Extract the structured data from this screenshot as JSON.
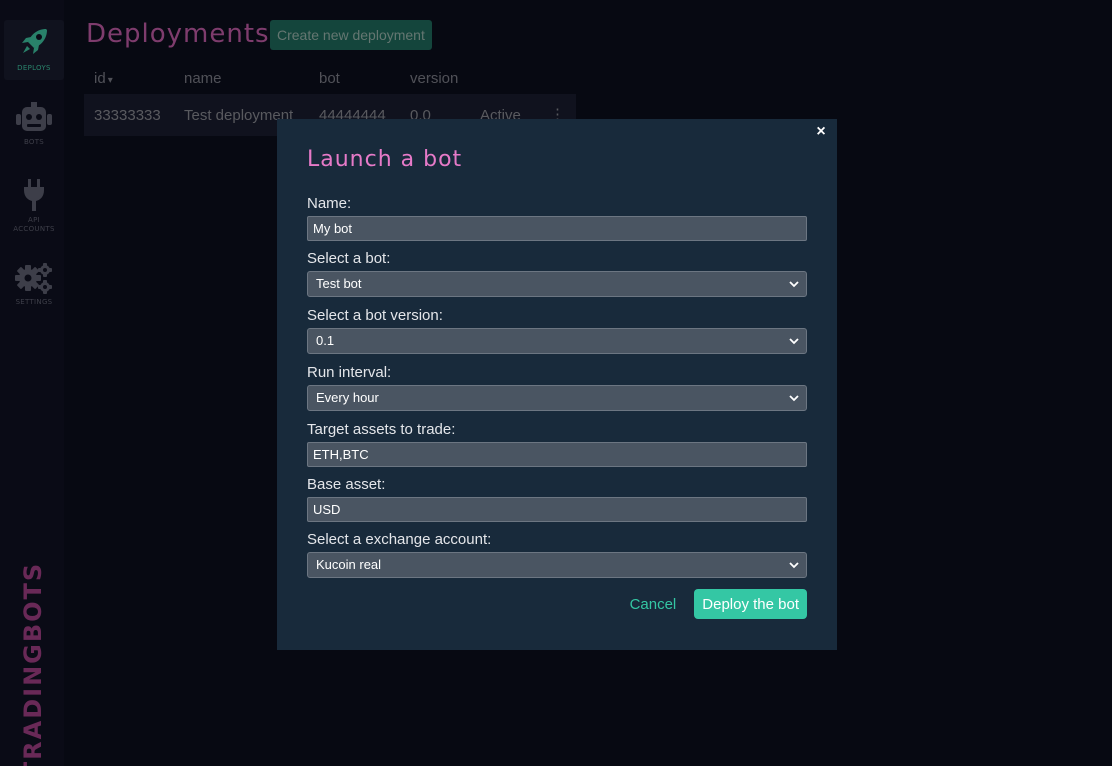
{
  "sidebar": {
    "items": [
      {
        "label": "Deploys",
        "icon": "rocket-icon"
      },
      {
        "label": "Bots",
        "icon": "robot-icon"
      },
      {
        "label": "API accounts",
        "icon": "plug-icon"
      },
      {
        "label": "Settings",
        "icon": "gears-icon"
      }
    ],
    "brand": "TRADINGBOTS"
  },
  "page": {
    "title": "Deployments",
    "create_button": "Create new deployment"
  },
  "table": {
    "columns": [
      "id",
      "name",
      "bot",
      "version"
    ],
    "sort_indicator": "▾",
    "rows": [
      {
        "id": "33333333",
        "name": "Test deployment",
        "bot": "44444444",
        "version": "0.0",
        "status": "Active",
        "menu": "⋮"
      }
    ]
  },
  "modal": {
    "close": "×",
    "title": "Launch a bot",
    "fields": {
      "name": {
        "label": "Name:",
        "value": "My bot"
      },
      "bot": {
        "label": "Select a bot:",
        "value": "Test bot"
      },
      "version": {
        "label": "Select a bot version:",
        "value": "0.1"
      },
      "interval": {
        "label": "Run interval:",
        "value": "Every hour"
      },
      "assets": {
        "label": "Target assets to trade:",
        "value": "ETH,BTC"
      },
      "base": {
        "label": "Base asset:",
        "value": "USD"
      },
      "account": {
        "label": "Select a exchange account:",
        "value": "Kucoin real"
      }
    },
    "cancel": "Cancel",
    "deploy": "Deploy the bot"
  },
  "colors": {
    "accent": "#34c7a4",
    "brand_pink": "#e67ac8",
    "background": "#0b0e1c",
    "modal_bg": "#182a3b"
  }
}
